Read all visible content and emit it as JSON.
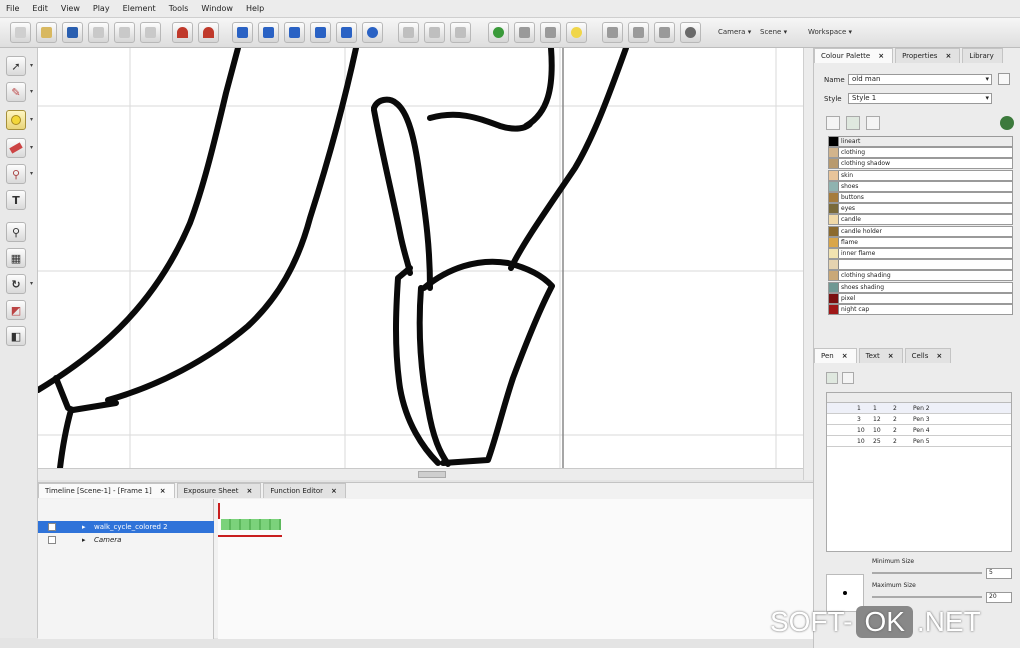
{
  "menu": [
    "File",
    "Edit",
    "View",
    "Play",
    "Element",
    "Tools",
    "Window",
    "Help"
  ],
  "toolbar": {
    "camera_label": "Camera",
    "scene_label": "Scene",
    "workspace_label": "Workspace"
  },
  "timeline": {
    "tabs": [
      "Timeline [Scene-1] - [Frame 1]",
      "Exposure Sheet",
      "Function Editor"
    ],
    "layers": [
      {
        "name": "walk_cycle_colored 2"
      },
      {
        "name": "Camera"
      }
    ]
  },
  "right_panel": {
    "palette_tabs": [
      "Colour Palette",
      "Properties",
      "Library"
    ],
    "name_label": "Name",
    "name_value": "old man",
    "style_label": "Style",
    "style_value": "Style 1",
    "colors": [
      {
        "name": "lineart",
        "color": "#000000"
      },
      {
        "name": "clothing",
        "color": "#d2b48c"
      },
      {
        "name": "clothing shadow",
        "color": "#b89a6e"
      },
      {
        "name": "skin",
        "color": "#e8c49a"
      },
      {
        "name": "shoes",
        "color": "#8fb3b0"
      },
      {
        "name": "buttons",
        "color": "#a67c3d"
      },
      {
        "name": "eyes",
        "color": "#7a6a3a"
      },
      {
        "name": "candle",
        "color": "#f0d9a8"
      },
      {
        "name": "candle holder",
        "color": "#8b6a2e"
      },
      {
        "name": "flame",
        "color": "#d9a64a"
      },
      {
        "name": "inner flame",
        "color": "#f2e3b0"
      },
      {
        "name": "",
        "color": "#e5d3b0"
      },
      {
        "name": "clothing shading",
        "color": "#c9a878"
      },
      {
        "name": "shoes shading",
        "color": "#6f9893"
      },
      {
        "name": "pixel",
        "color": "#7a1010"
      },
      {
        "name": "night cap",
        "color": "#a01818"
      }
    ],
    "pen_tabs": [
      "Pen",
      "Text",
      "Cells"
    ],
    "pens": [
      {
        "a": "1",
        "b": "1",
        "c": "2",
        "name": "Pen 2"
      },
      {
        "a": "3",
        "b": "12",
        "c": "2",
        "name": "Pen 3"
      },
      {
        "a": "10",
        "b": "10",
        "c": "2",
        "name": "Pen 4"
      },
      {
        "a": "10",
        "b": "25",
        "c": "2",
        "name": "Pen 5"
      }
    ],
    "min_size_label": "Minimum Size",
    "min_size_value": "5",
    "max_size_label": "Maximum Size",
    "max_size_value": "20"
  },
  "watermark": {
    "left": "SOFT-",
    "badge": "OK",
    "right": ".NET"
  }
}
